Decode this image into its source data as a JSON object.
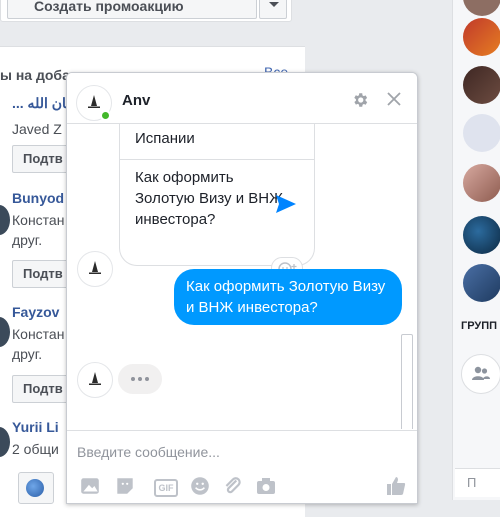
{
  "promo": {
    "button_label": "Создать промоакцию"
  },
  "friends": {
    "title": "ы на добавление в друзья",
    "see_all": "Все",
    "items": [
      {
        "name": "...افغان الله ...",
        "sub": "Javed Z",
        "button": "Подтв"
      },
      {
        "name": "Bunyod",
        "sub": "Констан",
        "sub2": "друг.",
        "button": "Подтв"
      },
      {
        "name": "Fayzov",
        "sub": "Констан",
        "sub2": "друг.",
        "button": "Подтв"
      },
      {
        "name": "Yurii Li",
        "sub": "2 общи"
      }
    ]
  },
  "chat": {
    "name": "Anv",
    "card_prev_text": "Испании",
    "card_text": "Как оформить Золотую Визу и ВНЖ инвестора?",
    "my_message": "Как оформить Золотую Визу и ВНЖ инвестора?",
    "input_placeholder": "Введите сообщение...",
    "gif_label": "GIF"
  },
  "sidebar": {
    "groups_label": "ГРУПП",
    "search_placeholder": "П"
  },
  "colors": {
    "messenger_blue": "#0099ff",
    "facebook_blue": "#4267b2",
    "online_green": "#42b72a"
  },
  "icons": [
    "gear-icon",
    "close-icon",
    "send-icon",
    "emoji-react-icon",
    "photo-icon",
    "sticker-icon",
    "gif-icon",
    "emoji-icon",
    "attachment-icon",
    "camera-icon",
    "like-icon",
    "globe-icon",
    "create-group-icon"
  ]
}
